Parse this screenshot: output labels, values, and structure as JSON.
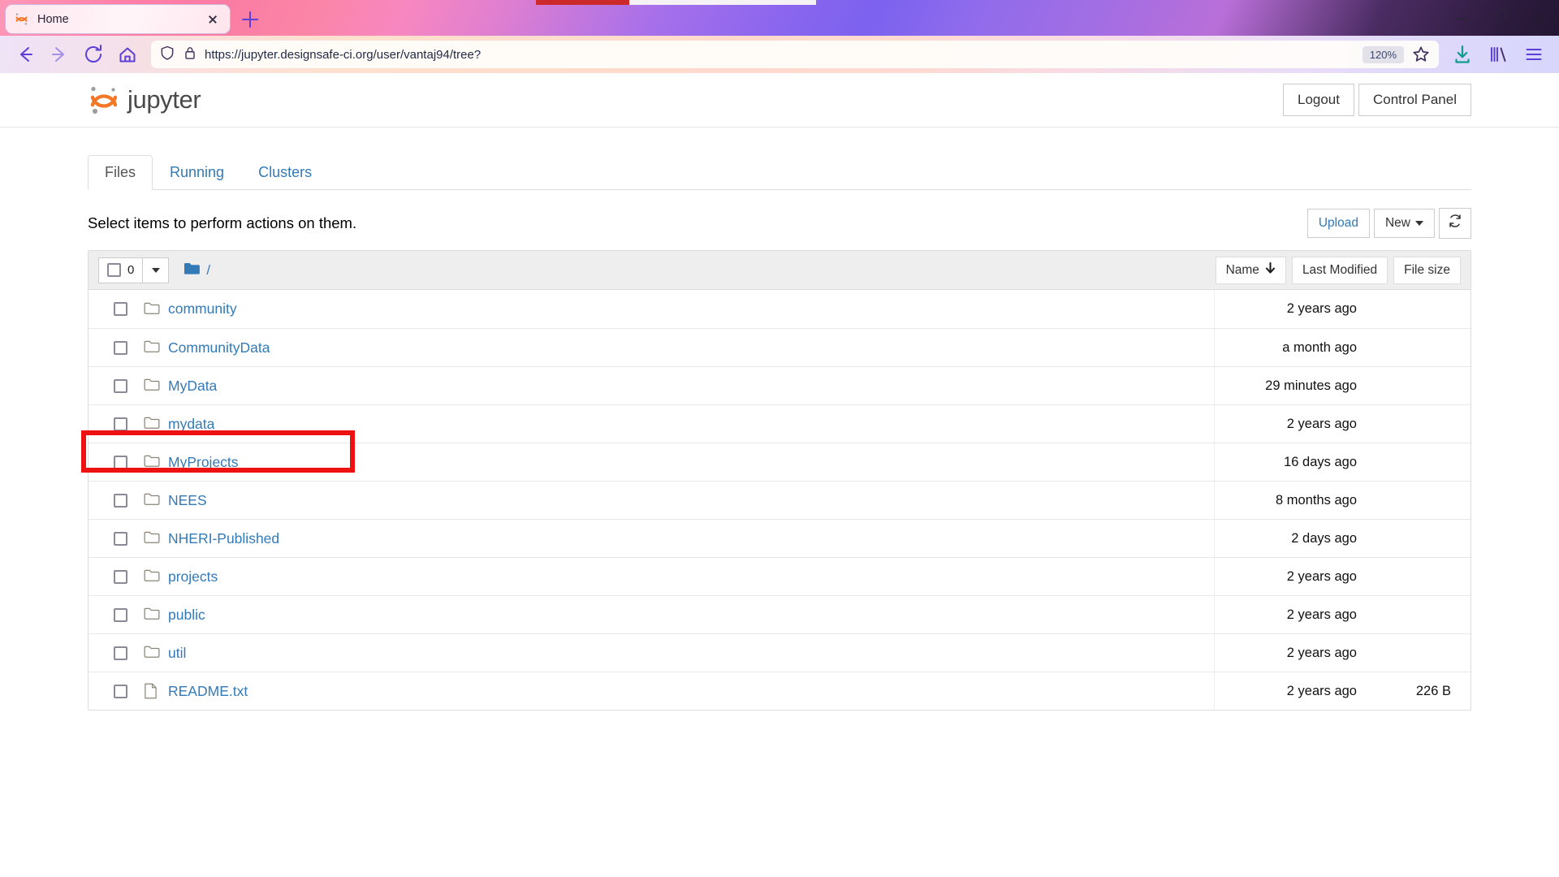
{
  "browser": {
    "tab": {
      "title": "Home",
      "favicon": "jupyter-favicon",
      "close_icon": "close-icon"
    },
    "new_tab_icon": "plus-icon",
    "window_controls": {
      "minimize": "minimize-icon",
      "maximize": "maximize-icon",
      "close": "close-icon"
    },
    "nav": {
      "back_icon": "back-arrow-icon",
      "forward_icon": "forward-arrow-icon",
      "reload_icon": "reload-icon",
      "home_icon": "home-icon",
      "shield_icon": "shield-icon",
      "lock_icon": "lock-icon",
      "url": "https://jupyter.designsafe-ci.org/user/vantaj94/tree?",
      "zoom_level": "120%",
      "bookmark_icon": "star-icon",
      "downloads_icon": "download-icon",
      "library_icon": "library-icon",
      "menu_icon": "hamburger-menu-icon"
    }
  },
  "header": {
    "logo_text": "jupyter",
    "logout_label": "Logout",
    "control_panel_label": "Control Panel"
  },
  "tabs": [
    {
      "label": "Files",
      "active": true
    },
    {
      "label": "Running",
      "active": false
    },
    {
      "label": "Clusters",
      "active": false
    }
  ],
  "toolbar": {
    "select_message": "Select items to perform actions on them.",
    "upload_label": "Upload",
    "new_label": "New",
    "refresh_icon": "refresh-icon"
  },
  "filelist": {
    "selected_count": "0",
    "breadcrumb_root": "/",
    "folder_icon": "folder-icon",
    "sort": {
      "name_label": "Name",
      "name_direction_icon": "arrow-down-icon",
      "last_modified_label": "Last Modified",
      "file_size_label": "File size"
    },
    "rows": [
      {
        "icon": "folder-icon",
        "name": "community",
        "modified": "2 years ago",
        "size": ""
      },
      {
        "icon": "folder-icon",
        "name": "CommunityData",
        "modified": "a month ago",
        "size": ""
      },
      {
        "icon": "folder-icon",
        "name": "MyData",
        "modified": "29 minutes ago",
        "size": "",
        "highlighted": true
      },
      {
        "icon": "folder-icon",
        "name": "mydata",
        "modified": "2 years ago",
        "size": ""
      },
      {
        "icon": "folder-icon",
        "name": "MyProjects",
        "modified": "16 days ago",
        "size": ""
      },
      {
        "icon": "folder-icon",
        "name": "NEES",
        "modified": "8 months ago",
        "size": ""
      },
      {
        "icon": "folder-icon",
        "name": "NHERI-Published",
        "modified": "2 days ago",
        "size": ""
      },
      {
        "icon": "folder-icon",
        "name": "projects",
        "modified": "2 years ago",
        "size": ""
      },
      {
        "icon": "folder-icon",
        "name": "public",
        "modified": "2 years ago",
        "size": ""
      },
      {
        "icon": "folder-icon",
        "name": "util",
        "modified": "2 years ago",
        "size": ""
      },
      {
        "icon": "file-icon",
        "name": "README.txt",
        "modified": "2 years ago",
        "size": "226 B"
      }
    ]
  },
  "annotation": {
    "type": "red-rectangle",
    "target": "MyData",
    "color": "#ee1111"
  }
}
